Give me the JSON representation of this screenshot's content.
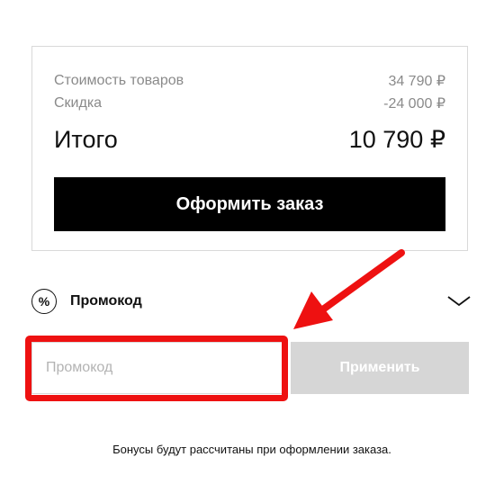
{
  "summary": {
    "cost_label": "Стоимость товаров",
    "cost_value": "34 790 ₽",
    "discount_label": "Скидка",
    "discount_value": "-24 000 ₽",
    "total_label": "Итого",
    "total_value": "10 790 ₽",
    "checkout_label": "Оформить заказ"
  },
  "promo": {
    "icon": "percent-icon",
    "icon_glyph": "%",
    "title": "Промокод",
    "chevron": "chevron-down-icon",
    "input_placeholder": "Промокод",
    "input_value": "",
    "apply_label": "Применить"
  },
  "note": "Бонусы будут рассчитаны при оформлении заказа.",
  "colors": {
    "checkout_bg": "#000000",
    "apply_bg": "#d6d6d6",
    "annotation_red": "#ee1111",
    "muted_text": "#8a8a8a"
  }
}
